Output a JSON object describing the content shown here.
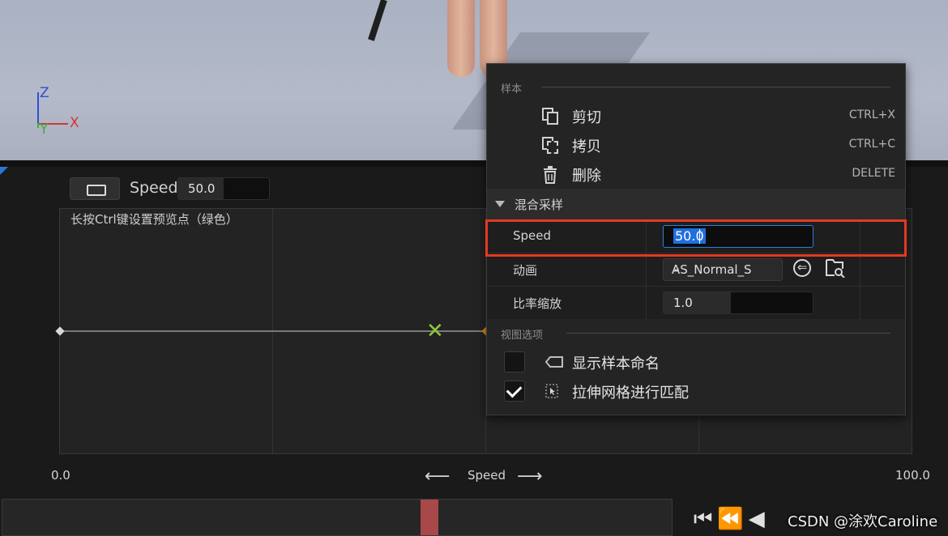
{
  "viewport": {
    "axes": {
      "z": "Z",
      "x": "X",
      "y": "Y"
    }
  },
  "toolbar": {
    "param_name": "Speed",
    "param_value": "50.0",
    "param_fill_fraction": 0.5
  },
  "grid": {
    "hint": "长按Ctrl键设置预览点（绿色）",
    "min_label": "0.0",
    "max_label": "100.0",
    "axis_label": "Speed",
    "arrow_left": "⟵",
    "arrow_right": "⟶"
  },
  "timeline": {
    "watermark": "CSDN @涂欢Caroline"
  },
  "menu": {
    "section_sample": "样本",
    "cut_label": "剪切",
    "cut_shortcut": "CTRL+X",
    "copy_label": "拷贝",
    "copy_shortcut": "CTRL+C",
    "delete_label": "删除",
    "delete_shortcut": "DELETE",
    "category_blend_sample": "混合采样",
    "speed_prop_label": "Speed",
    "speed_prop_value": "50.0",
    "anim_prop_label": "动画",
    "anim_prop_value": "AS_Normal_S",
    "rate_prop_label": "比率缩放",
    "rate_prop_value": "1.0",
    "rate_fill_fraction": 0.45,
    "section_view_options": "视图选项",
    "show_sample_names_label": "显示样本命名",
    "show_sample_names_checked": false,
    "stretch_grid_label": "拉伸网格进行匹配",
    "stretch_grid_checked": true
  },
  "colors": {
    "highlight": "#e23a20",
    "selection": "#1f6fe0",
    "preview_point": "#8fc73e",
    "sample_point": "#d7861c"
  }
}
